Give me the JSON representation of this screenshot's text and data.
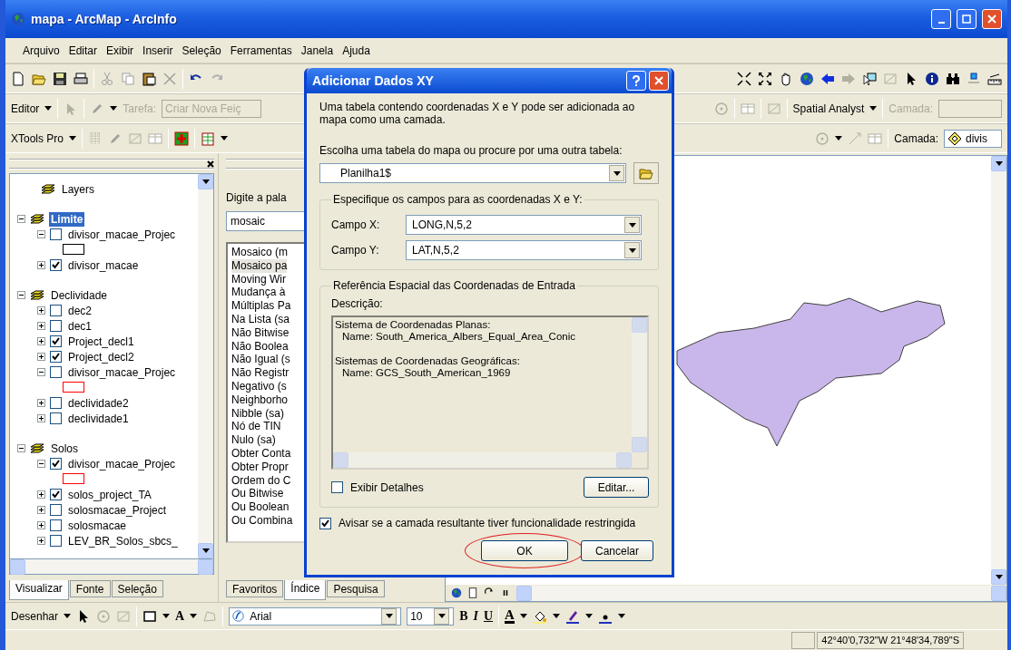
{
  "window": {
    "title": "mapa - ArcMap - ArcInfo"
  },
  "menu": [
    "Arquivo",
    "Editar",
    "Exibir",
    "Inserir",
    "Seleção",
    "Ferramentas",
    "Janela",
    "Ajuda"
  ],
  "editor_toolbar": {
    "editor_menu": "Editor",
    "task_label": "Tarefa:",
    "task_value": "Criar Nova Feiç",
    "spatial_analyst": "Spatial Analyst",
    "layer_label": "Camada:"
  },
  "xtools_toolbar": {
    "menu": "XTools Pro",
    "layer_label": "Camada:",
    "layer_value": "divis"
  },
  "toc": {
    "root": "Layers",
    "groups": [
      {
        "label": "Limite",
        "selected": true,
        "expanded": true,
        "layers": [
          {
            "label": "divisor_macae_Projec",
            "checked": false,
            "expanded": true,
            "color": "#000000"
          },
          {
            "label": "divisor_macae",
            "checked": true,
            "expanded": false
          }
        ]
      },
      {
        "label": "Declividade",
        "selected": false,
        "expanded": true,
        "layers": [
          {
            "label": "dec2",
            "checked": false,
            "expanded": false
          },
          {
            "label": "dec1",
            "checked": false,
            "expanded": false
          },
          {
            "label": "Project_decl1",
            "checked": true,
            "expanded": false
          },
          {
            "label": "Project_decl2",
            "checked": true,
            "expanded": false
          },
          {
            "label": "divisor_macae_Projec",
            "checked": false,
            "expanded": true,
            "color": "#ff0000"
          },
          {
            "label": "declividade2",
            "checked": false,
            "expanded": false
          },
          {
            "label": "declividade1",
            "checked": false,
            "expanded": false
          }
        ]
      },
      {
        "label": "Solos",
        "selected": false,
        "expanded": true,
        "layers": [
          {
            "label": "divisor_macae_Projec",
            "checked": true,
            "expanded": true,
            "color": "#ff0000"
          },
          {
            "label": "solos_project_TA",
            "checked": true,
            "expanded": false
          },
          {
            "label": "solosmacae_Project",
            "checked": false,
            "expanded": false
          },
          {
            "label": "solosmacae",
            "checked": false,
            "expanded": false
          },
          {
            "label": "LEV_BR_Solos_sbcs_",
            "checked": false,
            "expanded": false
          }
        ]
      }
    ],
    "tabs": [
      {
        "label": "Visualizar",
        "selected": true
      },
      {
        "label": "Fonte",
        "selected": false
      },
      {
        "label": "Seleção",
        "selected": false
      }
    ]
  },
  "search_panel": {
    "prompt": "Digite a pala",
    "query": "mosaic",
    "results": [
      {
        "label": "Mosaico (m",
        "selected": false
      },
      {
        "label": "Mosaico pa",
        "selected": true
      },
      {
        "label": "Moving Wir",
        "selected": false
      },
      {
        "label": "Mudança à",
        "selected": false
      },
      {
        "label": "Múltiplas Pa",
        "selected": false
      },
      {
        "label": "Na Lista (sa",
        "selected": false
      },
      {
        "label": "Não Bitwise",
        "selected": false
      },
      {
        "label": "Não Boolea",
        "selected": false
      },
      {
        "label": "Não Igual (s",
        "selected": false
      },
      {
        "label": "Não Registr",
        "selected": false
      },
      {
        "label": "Negativo (s",
        "selected": false
      },
      {
        "label": "Neighborho",
        "selected": false
      },
      {
        "label": "Nibble (sa)",
        "selected": false
      },
      {
        "label": "Nó de TIN",
        "selected": false
      },
      {
        "label": "Nulo (sa)",
        "selected": false
      },
      {
        "label": "Obter Conta",
        "selected": false
      },
      {
        "label": "Obter Propr",
        "selected": false
      },
      {
        "label": "Ordem do C",
        "selected": false
      },
      {
        "label": "Ou Bitwise",
        "selected": false
      },
      {
        "label": "Ou Boolean",
        "selected": false
      },
      {
        "label": "Ou Combina",
        "selected": false
      }
    ],
    "tabs": [
      {
        "label": "Favoritos",
        "selected": false
      },
      {
        "label": "Índice",
        "selected": true
      },
      {
        "label": "Pesquisa",
        "selected": false
      }
    ]
  },
  "dialog": {
    "title": "Adicionar Dados XY",
    "intro": "Uma tabela contendo coordenadas X e Y pode ser adicionada ao mapa como uma camada.",
    "table_label": "Escolha uma tabela do mapa ou procure por uma outra tabela:",
    "table_value": "Planilha1$",
    "fields_legend": "Especifique os campos para as coordenadas X e Y:",
    "fields": [
      {
        "label": "Campo X:",
        "value": "LONG,N,5,2"
      },
      {
        "label": "Campo Y:",
        "value": "LAT,N,5,2"
      }
    ],
    "reference_legend": "Referência Espacial das Coordenadas de Entrada",
    "description_label": "Descrição:",
    "description": [
      {
        "heading": "Sistema de Coordenadas Planas:",
        "name": "Name: South_America_Albers_Equal_Area_Conic"
      },
      {
        "heading": "Sistemas de Coordenadas Geográficas:",
        "name": "Name: GCS_South_American_1969"
      }
    ],
    "show_details": {
      "label": "Exibir Detalhes",
      "checked": false
    },
    "edit_button": "Editar...",
    "warn": {
      "label": "Avisar se a camada resultante tiver funcionalidade restringida",
      "checked": true
    },
    "buttons": [
      {
        "label": "OK",
        "circled": true
      },
      {
        "label": "Cancelar",
        "circled": false
      }
    ]
  },
  "draw_toolbar": {
    "menu": "Desenhar",
    "text_tool": "A",
    "font": "Arial",
    "size": "10",
    "bold": "B",
    "italic": "I",
    "underline": "U",
    "font_color": "A"
  },
  "status_bar": {
    "coordinates": "42°40'0,732\"W  21°48'34,789\"S"
  }
}
